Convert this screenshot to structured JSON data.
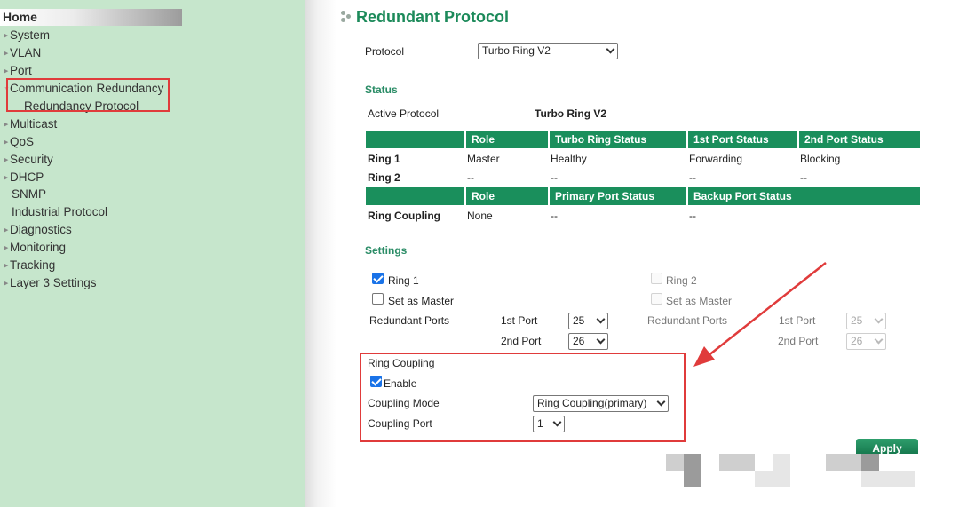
{
  "sidebar": {
    "home": "Home",
    "items": [
      {
        "label": "System",
        "arrow": "▶"
      },
      {
        "label": "VLAN",
        "arrow": "▶"
      },
      {
        "label": "Port",
        "arrow": "▶"
      },
      {
        "label": "Communication Redundancy",
        "arrow": "▼"
      },
      {
        "label": "Redundancy Protocol"
      },
      {
        "label": "Multicast",
        "arrow": "▶"
      },
      {
        "label": "QoS",
        "arrow": "▶"
      },
      {
        "label": "Security",
        "arrow": "▶"
      },
      {
        "label": "DHCP",
        "arrow": "▶"
      },
      {
        "label": "SNMP"
      },
      {
        "label": "Industrial Protocol"
      },
      {
        "label": "Diagnostics",
        "arrow": "▶"
      },
      {
        "label": "Monitoring",
        "arrow": "▶"
      },
      {
        "label": "Tracking",
        "arrow": "▶"
      },
      {
        "label": "Layer 3 Settings",
        "arrow": "▶"
      }
    ]
  },
  "main": {
    "title": "Redundant Protocol",
    "protocol_label": "Protocol",
    "protocol_value": "Turbo Ring V2",
    "status": {
      "heading": "Status",
      "active_label": "Active Protocol",
      "active_value": "Turbo Ring V2",
      "ring_headers": [
        "Role",
        "Turbo Ring Status",
        "1st Port Status",
        "2nd Port Status"
      ],
      "rings": [
        {
          "name": "Ring 1",
          "role": "Master",
          "status": "Healthy",
          "port1": "Forwarding",
          "port2": "Blocking"
        },
        {
          "name": "Ring 2",
          "role": "--",
          "status": "--",
          "port1": "--",
          "port2": "--"
        }
      ],
      "coupling_headers": [
        "Role",
        "Primary Port Status",
        "Backup Port Status"
      ],
      "coupling": {
        "name": "Ring Coupling",
        "role": "None",
        "primary": "--",
        "backup": "--"
      }
    },
    "settings": {
      "heading": "Settings",
      "ring1": {
        "label": "Ring 1",
        "checked": true,
        "master_label": "Set as Master",
        "master_checked": false,
        "ports_label": "Redundant Ports",
        "port1_label": "1st Port",
        "port1_value": "25",
        "port2_label": "2nd Port",
        "port2_value": "26"
      },
      "ring2": {
        "label": "Ring 2",
        "checked": false,
        "master_label": "Set as Master",
        "master_checked": false,
        "ports_label": "Redundant Ports",
        "port1_label": "1st Port",
        "port1_value": "25",
        "port2_label": "2nd Port",
        "port2_value": "26"
      },
      "coupling": {
        "heading": "Ring Coupling",
        "enable_label": "Enable",
        "enable_checked": true,
        "mode_label": "Coupling Mode",
        "mode_value": "Ring Coupling(primary)",
        "port_label": "Coupling Port",
        "port_value": "1"
      }
    },
    "apply_label": "Apply"
  },
  "colors": {
    "sidebar_bg": "#c6e6cc",
    "accent_green": "#1a8f5c",
    "title_green": "#1c8a5a",
    "annotation_red": "#e03b3b"
  }
}
